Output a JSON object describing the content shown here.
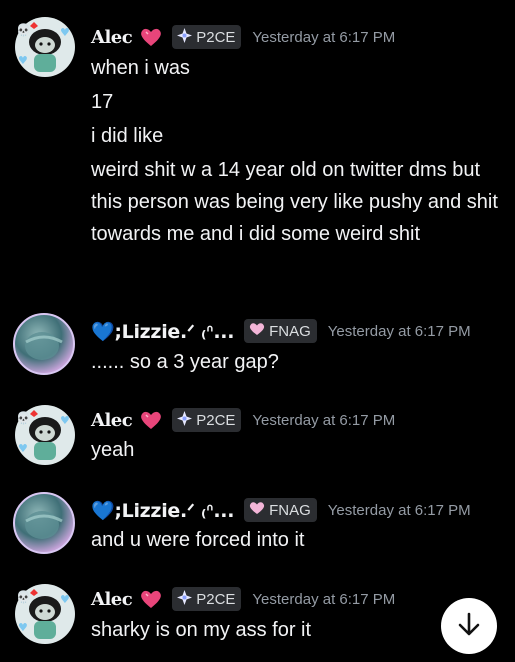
{
  "messages": [
    {
      "author": "Alec",
      "tag": "P2CE",
      "timestamp": "Yesterday at 6:17 PM",
      "lines": [
        "when i was",
        "17",
        "i did like",
        "weird shit w a 14 year old on twitter dms but this person was being very like pushy and shit towards me and i did some weird shit"
      ]
    },
    {
      "author": "💙;Lizzie.ᐟ ₍ᐢ...",
      "tag": "FNAG",
      "timestamp": "Yesterday at 6:17 PM",
      "lines": [
        "...... so a 3 year gap?"
      ]
    },
    {
      "author": "Alec",
      "tag": "P2CE",
      "timestamp": "Yesterday at 6:17 PM",
      "lines": [
        "yeah"
      ]
    },
    {
      "author": "💙;Lizzie.ᐟ ₍ᐢ...",
      "tag": "FNAG",
      "timestamp": "Yesterday at 6:17 PM",
      "lines": [
        "and u were forced into it"
      ]
    },
    {
      "author": "Alec",
      "tag": "P2CE",
      "timestamp": "Yesterday at 6:17 PM",
      "lines": [
        "sharky is on my ass for it"
      ]
    }
  ],
  "icons": {
    "heart": "pink-heart-icon",
    "p2ce_tag": "diamond-sparkle-icon",
    "fnag_tag": "pink-heart-icon",
    "scroll": "arrow-down-icon"
  },
  "colors": {
    "background": "#000000",
    "text": "#f2f3f5",
    "timestamp": "#949ba4",
    "tag_bg": "#2b2d31",
    "heart": "#e8457a"
  }
}
